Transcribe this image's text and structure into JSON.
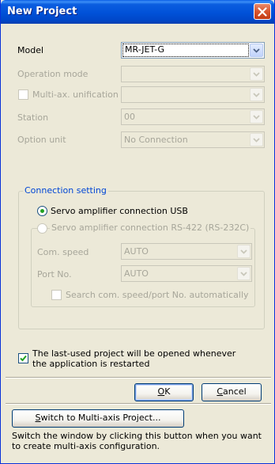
{
  "window": {
    "title": "New Project"
  },
  "model": {
    "label": "Model",
    "value": "MR-JET-G"
  },
  "operation_mode": {
    "label": "Operation mode",
    "value": ""
  },
  "multi_ax": {
    "label": "Multi-ax. unification",
    "value": ""
  },
  "station": {
    "label": "Station",
    "value": "00"
  },
  "option_unit": {
    "label": "Option unit",
    "value": "No Connection"
  },
  "connection": {
    "title": "Connection setting",
    "usb_label": "Servo amplifier connection USB",
    "rs422_label": "Servo amplifier connection RS-422 (RS-232C)",
    "com_speed": {
      "label": "Com. speed",
      "value": "AUTO"
    },
    "port_no": {
      "label": "Port No.",
      "value": "AUTO"
    },
    "search_label": "Search com. speed/port No. automatically"
  },
  "last_used": {
    "line1": "The last-used project will be opened whenever",
    "line2": "the application is restarted",
    "checked": true
  },
  "buttons": {
    "ok_u": "O",
    "ok_rest": "K",
    "cancel_u": "C",
    "cancel_rest": "ancel",
    "switch_u": "S",
    "switch_rest": "witch to Multi-axis Project..."
  },
  "hint": {
    "line1": "Switch the window by clicking this button when you want",
    "line2": "to create multi-axis configuration."
  },
  "colors": {
    "title_bar": "#0051d8",
    "dialog_bg": "#ece9d8",
    "radio_dot": "#21a121",
    "check_mark": "#21a121"
  }
}
